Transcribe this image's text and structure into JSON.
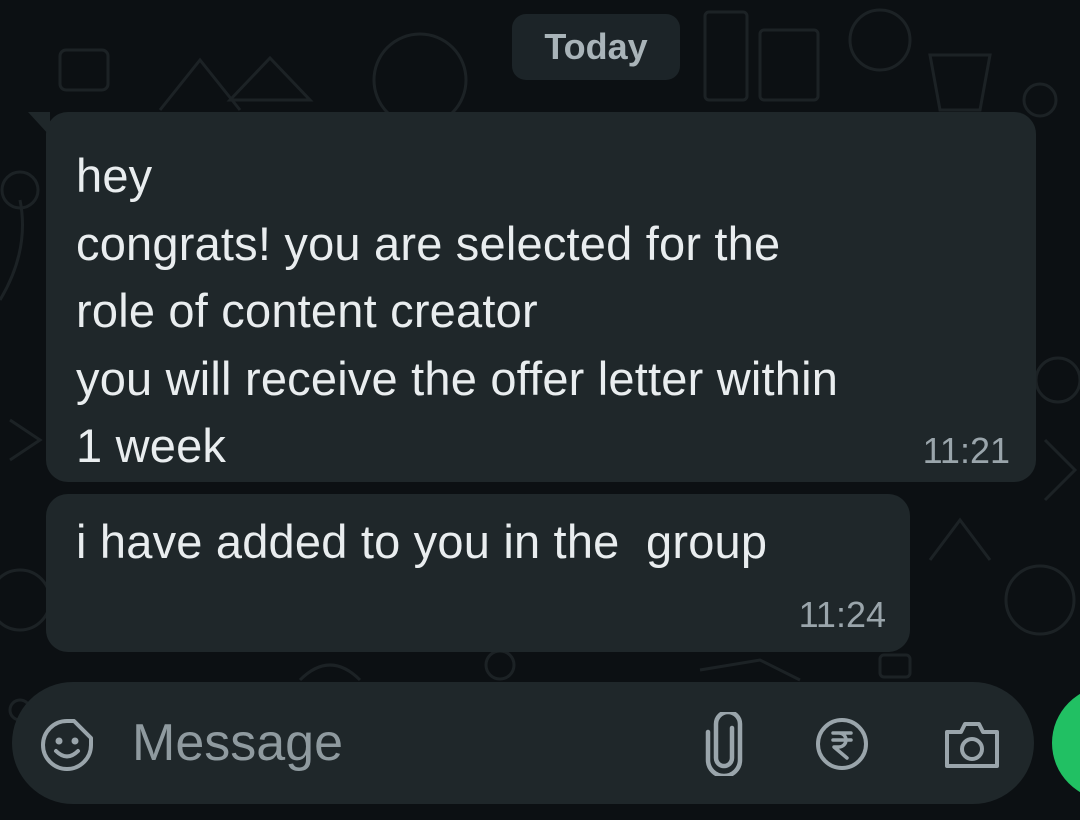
{
  "chat": {
    "date_separator": "Today",
    "messages": [
      {
        "text": "hey\ncongrats! you are selected for the\nrole of content creator\nyou will receive the offer letter within\n1 week",
        "time": "11:21"
      },
      {
        "text": "i have added to you in the  group",
        "time": "11:24"
      }
    ]
  },
  "composer": {
    "placeholder": "Message",
    "icons": {
      "emoji": "sticker-smiley-icon",
      "attach": "paperclip-icon",
      "payment": "rupee-icon",
      "camera": "camera-icon",
      "send": "mic-icon"
    }
  },
  "colors": {
    "background": "#0c1013",
    "bubble": "#1f272a",
    "accent": "#21c063"
  }
}
